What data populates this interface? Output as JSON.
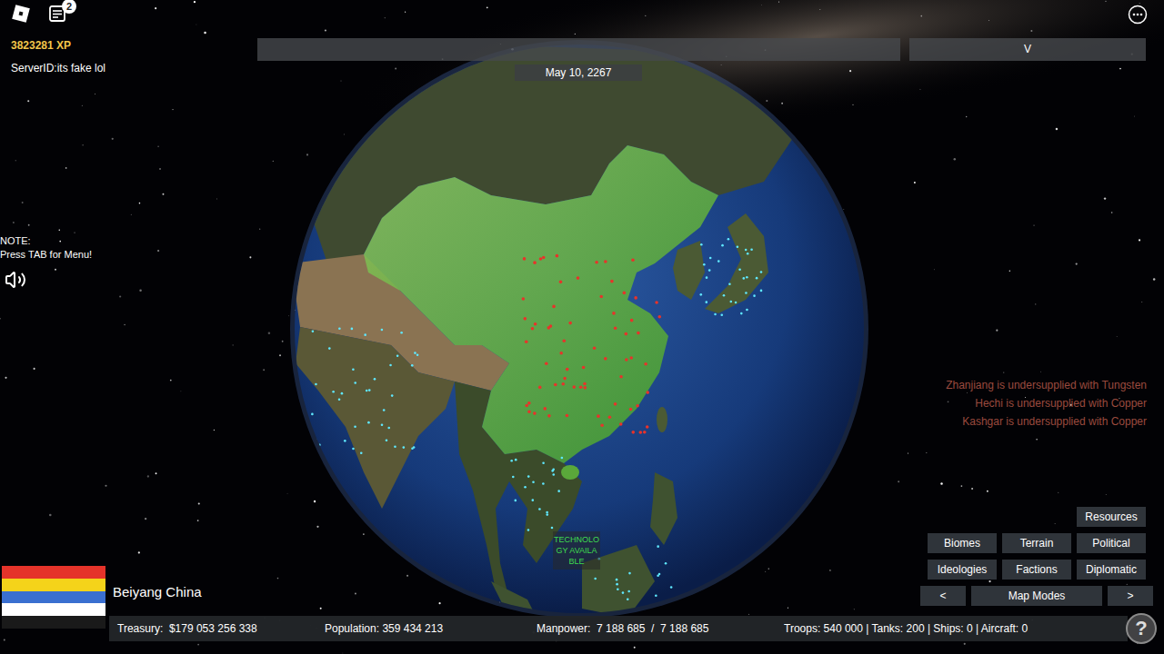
{
  "player": {
    "xp": "3823281 XP",
    "server": "ServerID:its fake lol"
  },
  "topbar": {
    "notifications": "2",
    "dropdown": "V"
  },
  "date": "May 10, 2267",
  "note": [
    "NOTE:",
    "Press TAB for Menu!"
  ],
  "alerts": [
    "Zhanjiang is undersupplied with Tungsten",
    "Hechi is undersupplied with Copper",
    "Kashgar is undersupplied with Copper"
  ],
  "tech_notice": "TECHNOLOGY AVAILABLE",
  "map_modes": {
    "rows": [
      [
        {
          "label": "Resources"
        }
      ],
      [
        {
          "label": "Biomes"
        },
        {
          "label": "Terrain"
        },
        {
          "label": "Political"
        }
      ],
      [
        {
          "label": "Ideologies"
        },
        {
          "label": "Factions"
        },
        {
          "label": "Diplomatic"
        }
      ]
    ],
    "nav": {
      "prev": "<",
      "title": "Map Modes",
      "next": ">"
    }
  },
  "nation": {
    "name": "Beiyang China",
    "flag": [
      "#e5332a",
      "#f4d31a",
      "#3a6fd0",
      "#ffffff",
      "#1a1a1a"
    ]
  },
  "stats": [
    "Treasury:  $179 053 256 338",
    "Population: 359 434 213",
    "Manpower:  7 188 685  /  7 188 685",
    "Troops: 540 000 | Tanks: 200 | Ships: 0 | Aircraft: 0"
  ],
  "help": "?"
}
